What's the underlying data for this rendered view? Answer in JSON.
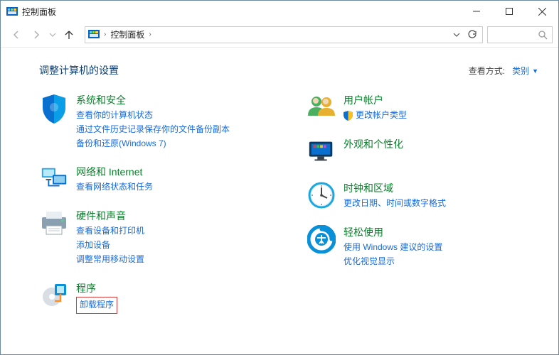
{
  "window": {
    "title": "控制面板"
  },
  "breadcrumb": {
    "root": "控制面板"
  },
  "page": {
    "heading": "调整计算机的设置",
    "view_label": "查看方式:",
    "view_value": "类别"
  },
  "left": [
    {
      "title": "系统和安全",
      "links": [
        "查看你的计算机状态",
        "通过文件历史记录保存你的文件备份副本",
        "备份和还原(Windows 7)"
      ]
    },
    {
      "title": "网络和 Internet",
      "links": [
        "查看网络状态和任务"
      ]
    },
    {
      "title": "硬件和声音",
      "links": [
        "查看设备和打印机",
        "添加设备",
        "调整常用移动设置"
      ]
    },
    {
      "title": "程序",
      "links": [
        "卸载程序"
      ]
    }
  ],
  "right": [
    {
      "title": "用户帐户",
      "links": [
        "更改帐户类型"
      ]
    },
    {
      "title": "外观和个性化",
      "links": []
    },
    {
      "title": "时钟和区域",
      "links": [
        "更改日期、时间或数字格式"
      ]
    },
    {
      "title": "轻松使用",
      "links": [
        "使用 Windows 建议的设置",
        "优化视觉显示"
      ]
    }
  ]
}
